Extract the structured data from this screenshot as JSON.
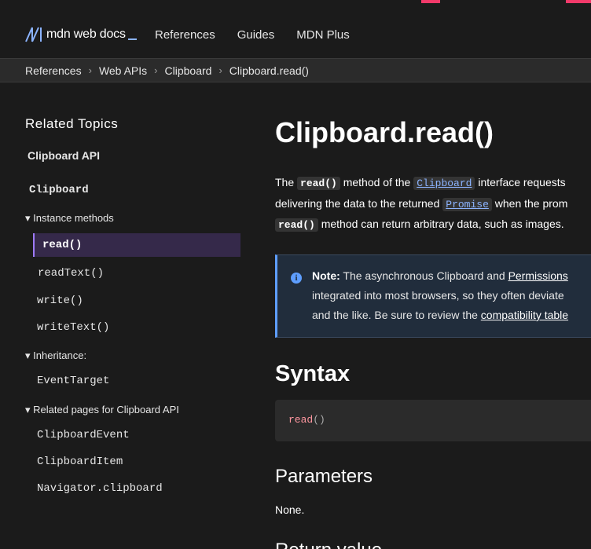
{
  "header": {
    "logo_text": "mdn web docs",
    "nav": [
      "References",
      "Guides",
      "MDN Plus"
    ]
  },
  "breadcrumbs": [
    "References",
    "Web APIs",
    "Clipboard",
    "Clipboard.read()"
  ],
  "sidebar": {
    "title": "Related Topics",
    "api_title": "Clipboard API",
    "interface": "Clipboard",
    "instance_methods_label": "Instance methods",
    "methods": [
      "read()",
      "readText()",
      "write()",
      "writeText()"
    ],
    "inheritance_label": "Inheritance:",
    "inheritance": [
      "EventTarget"
    ],
    "related_label": "Related pages for Clipboard API",
    "related": [
      "ClipboardEvent",
      "ClipboardItem",
      "Navigator.clipboard"
    ]
  },
  "main": {
    "title": "Clipboard.read()",
    "intro": {
      "t1": "The ",
      "code1": "read()",
      "t2": " method of the ",
      "link1": "Clipboard",
      "t3": " interface requests",
      "t4": "delivering the data to the returned ",
      "link2": "Promise",
      "t5": " when the prom",
      "code2": "read()",
      "t6": " method can return arbitrary data, such as images."
    },
    "note": {
      "label": "Note:",
      "l1": " The asynchronous Clipboard and ",
      "link1": "Permissions",
      "l2": "integrated into most browsers, so they often deviate",
      "l3": "and the like. Be sure to review the ",
      "link2": "compatibility table"
    },
    "syntax_heading": "Syntax",
    "syntax_code": "read",
    "syntax_parens": "()",
    "parameters_heading": "Parameters",
    "parameters_text": "None.",
    "return_heading": "Return value"
  }
}
